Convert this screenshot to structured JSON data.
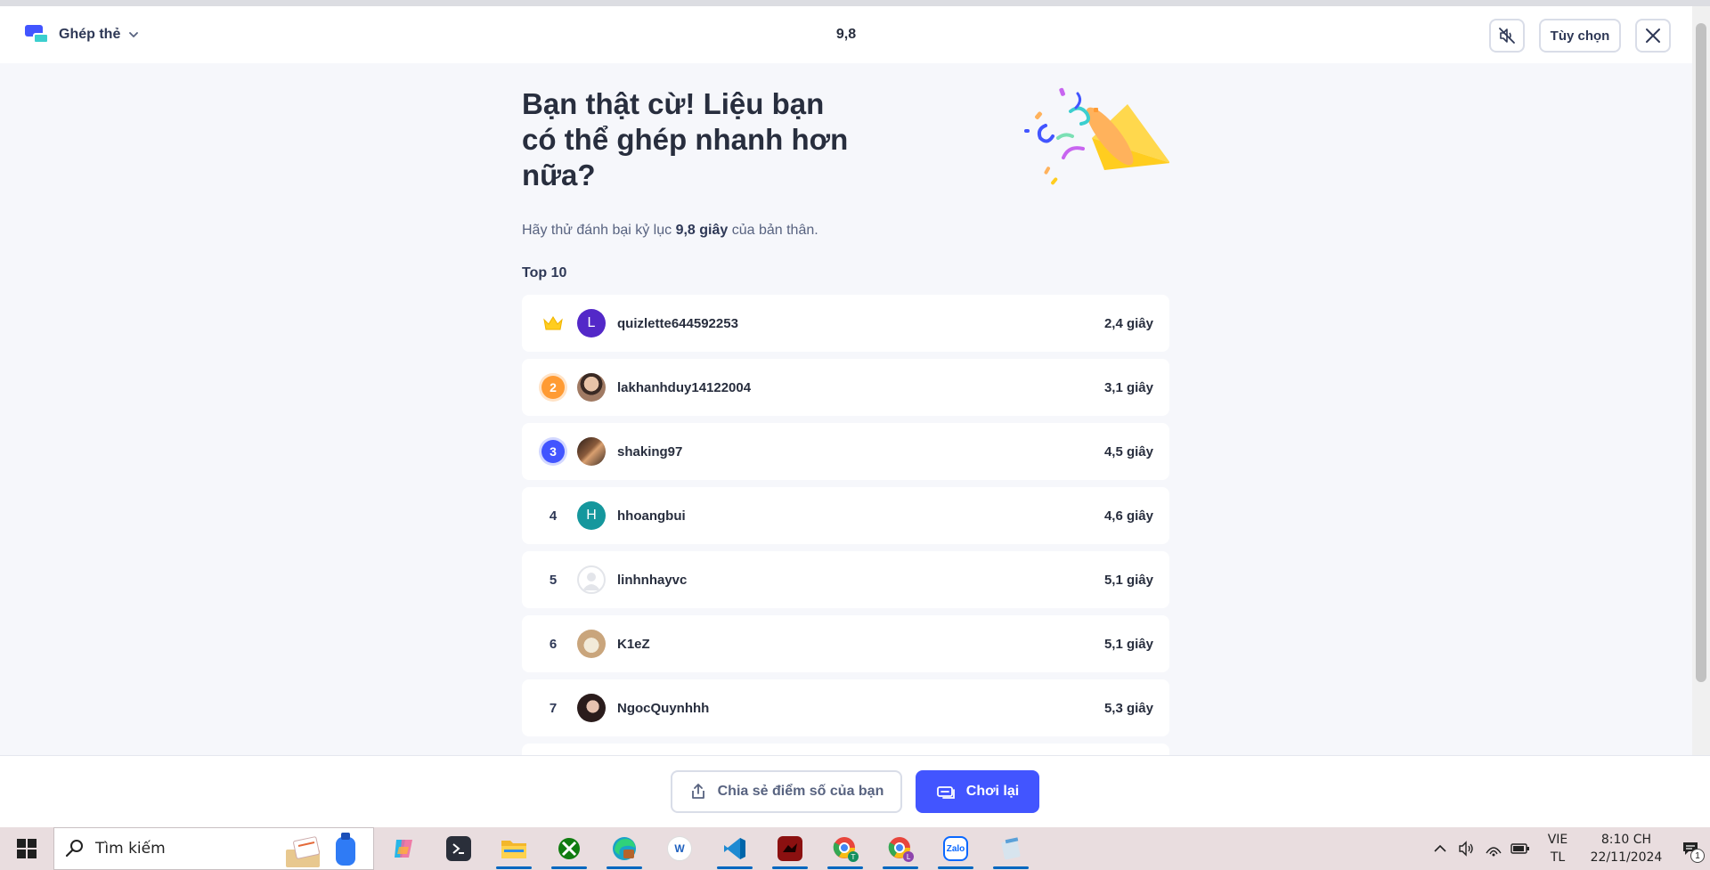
{
  "header": {
    "mode_label": "Ghép thẻ",
    "timer": "9,8",
    "options_label": "Tùy chọn"
  },
  "main": {
    "headline": "Bạn thật cừ! Liệu bạn có thể ghép nhanh hơn nữa?",
    "subtext_prefix": "Hãy thử đánh bại kỷ lục ",
    "subtext_record": "9,8 giây",
    "subtext_suffix": " của bản thân.",
    "top_label": "Top 10",
    "leaderboard": [
      {
        "rank": "1",
        "name": "quizlette644592253",
        "score": "2,4 giây",
        "avatar_letter": "L",
        "avatar_color": "#5328c8"
      },
      {
        "rank": "2",
        "name": "lakhanhduy14122004",
        "score": "3,1 giây",
        "avatar_letter": "",
        "avatar_color": "#a07a63"
      },
      {
        "rank": "3",
        "name": "shaking97",
        "score": "4,5 giây",
        "avatar_letter": "",
        "avatar_color": "#5a3a2e"
      },
      {
        "rank": "4",
        "name": "hhoangbui",
        "score": "4,6 giây",
        "avatar_letter": "H",
        "avatar_color": "#15979d"
      },
      {
        "rank": "5",
        "name": "linhnhayvc",
        "score": "5,1 giây",
        "avatar_letter": "",
        "avatar_color": "#e3e5ea"
      },
      {
        "rank": "6",
        "name": "K1eZ",
        "score": "5,1 giây",
        "avatar_letter": "",
        "avatar_color": "#c9a57c"
      },
      {
        "rank": "7",
        "name": "NgocQuynhhh",
        "score": "5,3 giây",
        "avatar_letter": "",
        "avatar_color": "#3b2a2a"
      }
    ]
  },
  "footer": {
    "share_label": "Chia sẻ điểm số của bạn",
    "replay_label": "Chơi lại"
  },
  "taskbar": {
    "search_placeholder": "Tìm kiếm",
    "apps": [
      {
        "icon": "copilot-icon",
        "active": false
      },
      {
        "icon": "terminal-icon",
        "active": false
      },
      {
        "icon": "file-explorer-icon",
        "active": true
      },
      {
        "icon": "xbox-icon",
        "active": true
      },
      {
        "icon": "edge-icon",
        "active": true
      },
      {
        "icon": "word-app-icon",
        "active": false
      },
      {
        "icon": "vscode-icon",
        "active": true
      },
      {
        "icon": "game-app-icon",
        "active": true
      },
      {
        "icon": "chrome-profile-t-icon",
        "active": true
      },
      {
        "icon": "chrome-profile-l-icon",
        "active": true
      },
      {
        "icon": "zalo-icon",
        "active": true
      },
      {
        "icon": "notepad-icon",
        "active": true
      }
    ],
    "lang_top": "VIE",
    "lang_bottom": "TL",
    "time": "8:10 CH",
    "date": "22/11/2024",
    "notification_count": "1"
  },
  "colors": {
    "accent": "#4255ff",
    "background": "#f6f7fb",
    "taskbar": "#e9dddf"
  }
}
